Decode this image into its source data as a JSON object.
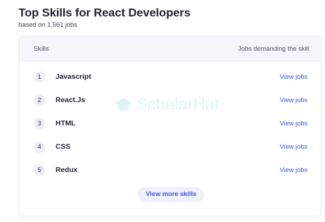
{
  "header": {
    "title": "Top Skills for React Developers",
    "subtitle": "based on 1,561 jobs"
  },
  "table": {
    "col_skills": "Skills",
    "col_jobs": "Jobs demanding the skill",
    "rows": [
      {
        "rank": "1",
        "skill": "Javascript",
        "link": "View jobs"
      },
      {
        "rank": "2",
        "skill": "React.Js",
        "link": "View jobs"
      },
      {
        "rank": "3",
        "skill": "HTML",
        "link": "View jobs"
      },
      {
        "rank": "4",
        "skill": "CSS",
        "link": "View jobs"
      },
      {
        "rank": "5",
        "skill": "Redux",
        "link": "View jobs"
      }
    ]
  },
  "more_button": "View more skills",
  "watermark": {
    "text": "ScholarHat",
    "icon": "graduation-cap-icon"
  },
  "colors": {
    "accent": "#3d5bd9",
    "header_bg": "#f5f6fb",
    "badge_bg": "#eceef8",
    "button_bg": "#eef0fb",
    "watermark": "#2ea3a0"
  }
}
